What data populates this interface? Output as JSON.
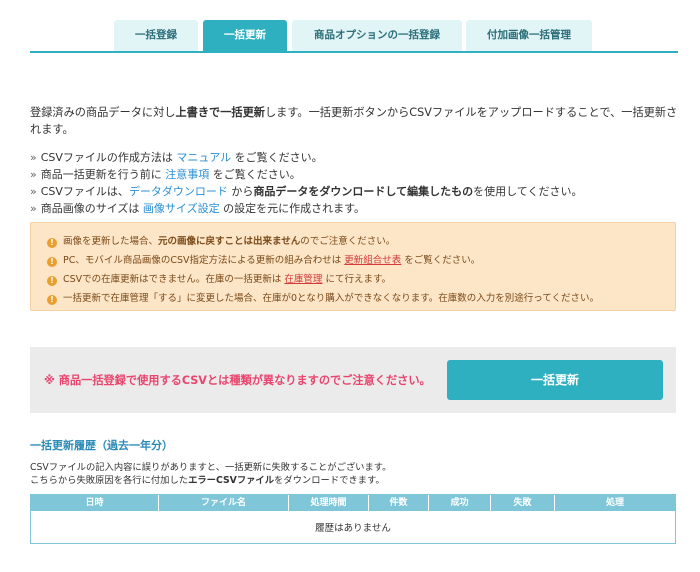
{
  "tabs": [
    {
      "label": "一括登録",
      "active": false
    },
    {
      "label": "一括更新",
      "active": true
    },
    {
      "label": "商品オプションの一括登録",
      "active": false
    },
    {
      "label": "付加画像一括管理",
      "active": false
    }
  ],
  "intro": {
    "part1": "登録済みの商品データに対し",
    "emphasis": "上書きで一括更新",
    "part2": "します。一括更新ボタンからCSVファイルをアップロードすることで、一括更新されます。"
  },
  "notes": {
    "n1": {
      "pre": "CSVファイルの作成方法は ",
      "link": "マニュアル",
      "post": " をご覧ください。"
    },
    "n2": {
      "pre": "商品一括更新を行う前に ",
      "link": "注意事項",
      "post": " をご覧ください。"
    },
    "n3": {
      "pre": "CSVファイルは、",
      "link": "データダウンロード",
      "mid": " から",
      "bold": "商品データをダウンロードして編集したもの",
      "post": "を使用してください。"
    },
    "n4": {
      "pre": "商品画像のサイズは ",
      "link": "画像サイズ設定",
      "post": " の設定を元に作成されます。"
    }
  },
  "warnings": {
    "w1": {
      "pre": "画像を更新した場合、",
      "bold": "元の画像に戻すことは出来ません",
      "post": "のでご注意ください。"
    },
    "w2": {
      "pre": "PC、モバイル商品画像のCSV指定方法による更新の組み合わせは ",
      "link": "更新組合せ表",
      "post": " をご覧ください。"
    },
    "w3": {
      "pre": "CSVでの在庫更新はできません。在庫の一括更新は ",
      "link": "在庫管理",
      "post": " にて行えます。"
    },
    "w4": {
      "text": "一括更新で在庫管理「する」に変更した場合、在庫が0となり購入ができなくなります。在庫数の入力を別途行ってください。"
    }
  },
  "action": {
    "caution": "※ 商品一括登録で使用するCSVとは種類が異なりますのでご注意ください。",
    "button": "一括更新"
  },
  "history": {
    "title": "一括更新履歴（過去一年分）",
    "desc1": "CSVファイルの記入内容に誤りがありますと、一括更新に失敗することがございます。",
    "desc2_pre": "こちらから失敗原因を各行に付加した",
    "desc2_bold": "エラーCSVファイル",
    "desc2_post": "をダウンロードできます。",
    "columns": [
      "日時",
      "ファイル名",
      "処理時間",
      "件数",
      "成功",
      "失敗",
      "処理"
    ],
    "empty": "履歴はありません"
  },
  "colors": {
    "accent": "#2fb0c0",
    "warning_bg": "#fde5c7",
    "caution": "#e9456e",
    "link": "#2b8fd4"
  }
}
